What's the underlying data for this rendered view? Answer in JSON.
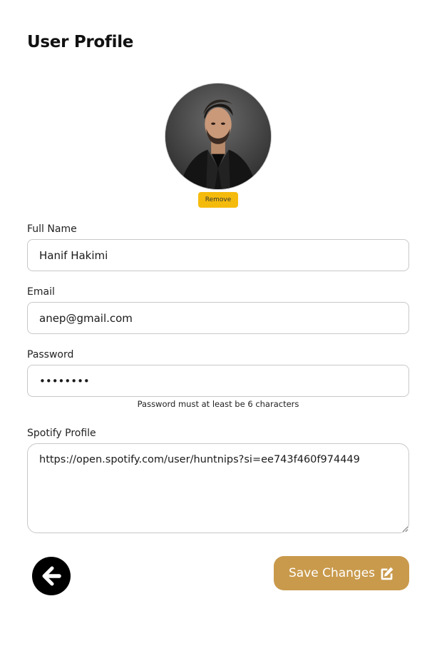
{
  "header": {
    "title": "User Profile"
  },
  "avatar": {
    "remove_label": "Remove"
  },
  "form": {
    "full_name": {
      "label": "Full Name",
      "value": "Hanif Hakimi"
    },
    "email": {
      "label": "Email",
      "value": "anep@gmail.com"
    },
    "password": {
      "label": "Password",
      "value": "12345678",
      "hint": "Password must at least be 6 characters"
    },
    "spotify": {
      "label": "Spotify Profile",
      "value": "https://open.spotify.com/user/huntnips?si=ee743f460f974449"
    }
  },
  "actions": {
    "save_label": "Save Changes",
    "back_icon": "arrow-left-circle-icon",
    "save_icon": "edit-icon"
  },
  "colors": {
    "accent": "#c99a4c",
    "remove": "#f5bb0c",
    "back": "#000000"
  }
}
